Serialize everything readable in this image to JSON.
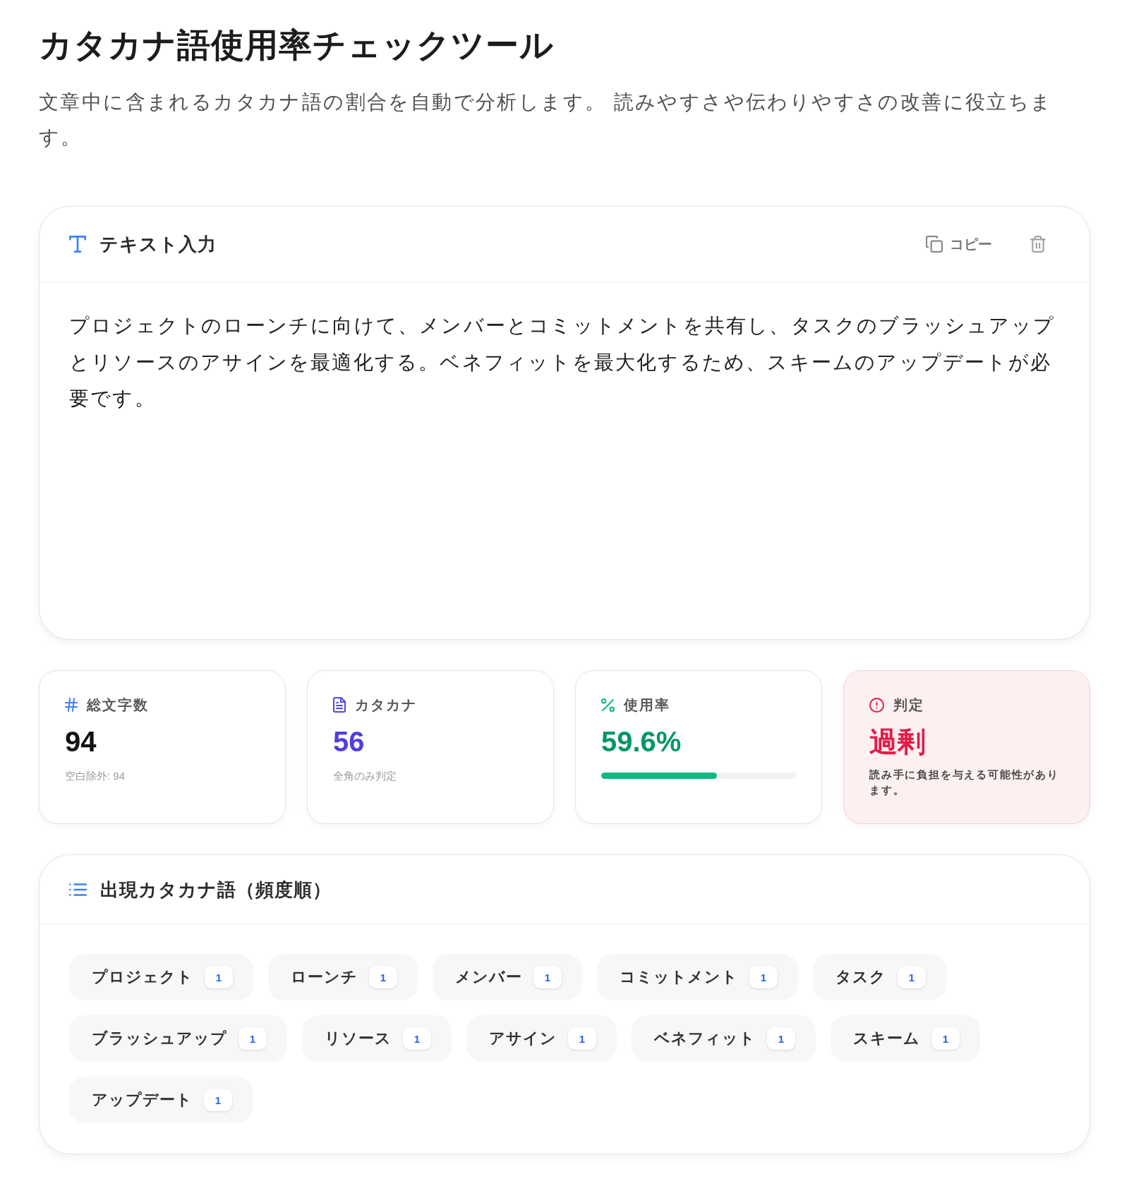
{
  "page": {
    "title": "カタカナ語使用率チェックツール",
    "description": "文章中に含まれるカタカナ語の割合を自動で分析します。 読みやすさや伝わりやすさの改善に役立ちます。"
  },
  "input_panel": {
    "title": "テキスト入力",
    "copy_button": "コピー",
    "text": "プロジェクトのローンチに向けて、メンバーとコミットメントを共有し、タスクのブラッシュアップとリソースのアサインを最適化する。ベネフィットを最大化するため、スキームのアップデートが必要です。"
  },
  "stats": [
    {
      "kind": "total",
      "label": "総文字数",
      "value": "94",
      "note": "空白除外: 94"
    },
    {
      "kind": "katakana",
      "label": "カタカナ",
      "value": "56",
      "note": "全角のみ判定"
    },
    {
      "kind": "rate",
      "label": "使用率",
      "value": "59.6%",
      "level": 0.596
    },
    {
      "kind": "verdict",
      "label": "判定",
      "value": "過剰",
      "note": "読み手に負担を与える可能性があります。"
    }
  ],
  "words_panel": {
    "title": "出現カタカナ語（頻度順）",
    "words": [
      {
        "word": "プロジェクト",
        "count": "1"
      },
      {
        "word": "ローンチ",
        "count": "1"
      },
      {
        "word": "メンバー",
        "count": "1"
      },
      {
        "word": "コミットメント",
        "count": "1"
      },
      {
        "word": "タスク",
        "count": "1"
      },
      {
        "word": "ブラッシュアップ",
        "count": "1"
      },
      {
        "word": "リソース",
        "count": "1"
      },
      {
        "word": "アサイン",
        "count": "1"
      },
      {
        "word": "ベネフィット",
        "count": "1"
      },
      {
        "word": "スキーム",
        "count": "1"
      },
      {
        "word": "アップデート",
        "count": "1"
      }
    ]
  }
}
